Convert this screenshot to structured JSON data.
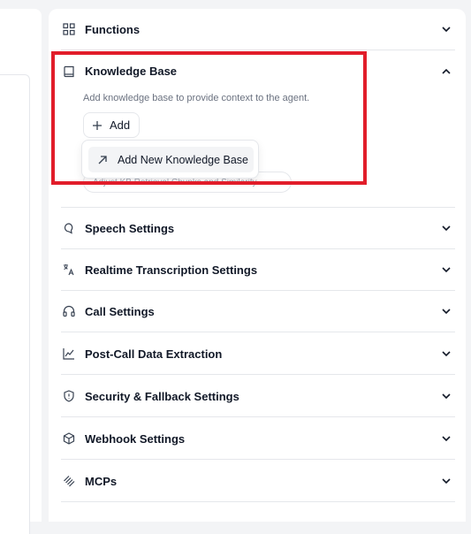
{
  "sections": [
    {
      "label": "Functions",
      "icon": "grid-icon",
      "expanded": false
    },
    {
      "label": "Knowledge Base",
      "icon": "book-icon",
      "expanded": true
    },
    {
      "label": "Speech Settings",
      "icon": "speech-icon",
      "expanded": false
    },
    {
      "label": "Realtime Transcription Settings",
      "icon": "translate-icon",
      "expanded": false
    },
    {
      "label": "Call Settings",
      "icon": "headphones-icon",
      "expanded": false
    },
    {
      "label": "Post-Call Data Extraction",
      "icon": "chart-line-icon",
      "expanded": false
    },
    {
      "label": "Security & Fallback Settings",
      "icon": "shield-icon",
      "expanded": false
    },
    {
      "label": "Webhook Settings",
      "icon": "cube-icon",
      "expanded": false
    },
    {
      "label": "MCPs",
      "icon": "mcp-icon",
      "expanded": false
    }
  ],
  "knowledge_base": {
    "description": "Add knowledge base to provide context to the agent.",
    "add_label": "Add",
    "dropdown_item": "Add New Knowledge Base",
    "obscured_chip": "Adjust KB Retrieval Chunks and Similarity"
  },
  "colors": {
    "highlight": "#e11d2a",
    "background": "#f3f4f6",
    "panel": "#ffffff"
  }
}
